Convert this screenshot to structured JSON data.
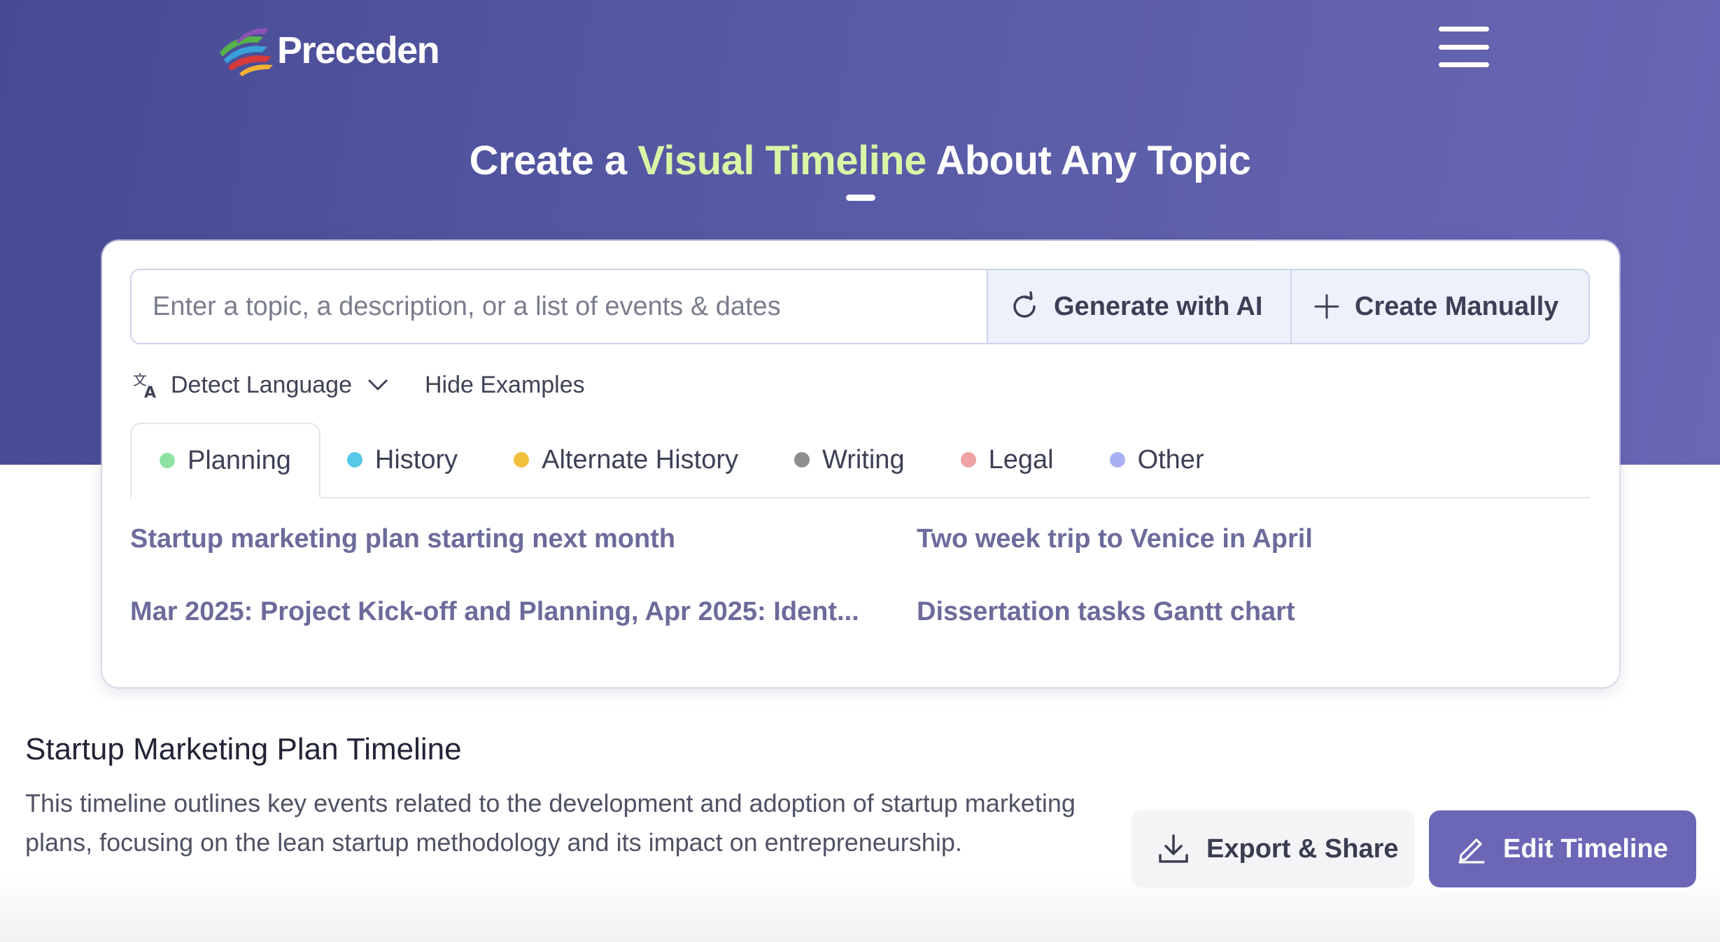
{
  "header": {
    "logo_text": "Preceden",
    "menu_icon": "hamburger-menu-icon"
  },
  "hero": {
    "title_before": "Create a ",
    "title_accent": "Visual Timeline",
    "title_after": " About Any Topic"
  },
  "search": {
    "placeholder": "Enter a topic, a description, or a list of events & dates",
    "value": "",
    "generate_label": "Generate with AI",
    "create_label": "Create Manually"
  },
  "options": {
    "language_label": "Detect Language",
    "hide_examples_label": "Hide Examples"
  },
  "tabs": [
    {
      "label": "Planning",
      "color": "#8fe3a2",
      "active": true
    },
    {
      "label": "History",
      "color": "#56c8e8",
      "active": false
    },
    {
      "label": "Alternate History",
      "color": "#f1bf3c",
      "active": false
    },
    {
      "label": "Writing",
      "color": "#8e8e8e",
      "active": false
    },
    {
      "label": "Legal",
      "color": "#f0a3a3",
      "active": false
    },
    {
      "label": "Other",
      "color": "#a8b0f3",
      "active": false
    }
  ],
  "examples": [
    "Startup marketing plan starting next month",
    "Two week trip to Venice in April",
    "Mar 2025: Project Kick-off and Planning, Apr 2025: Ident...",
    "Dissertation tasks Gantt chart"
  ],
  "timeline": {
    "title": "Startup Marketing Plan Timeline",
    "description": "This timeline outlines key events related to the development and adoption of startup marketing plans, focusing on the lean startup methodology and its impact on entrepreneurship.",
    "export_label": "Export & Share",
    "edit_label": "Edit Timeline"
  },
  "colors": {
    "hero_gradient_start": "#474a93",
    "hero_gradient_end": "#6a67b5",
    "accent_text": "#d9f5a6",
    "primary_button": "#6b66b6",
    "example_link": "#6c6b9b"
  }
}
